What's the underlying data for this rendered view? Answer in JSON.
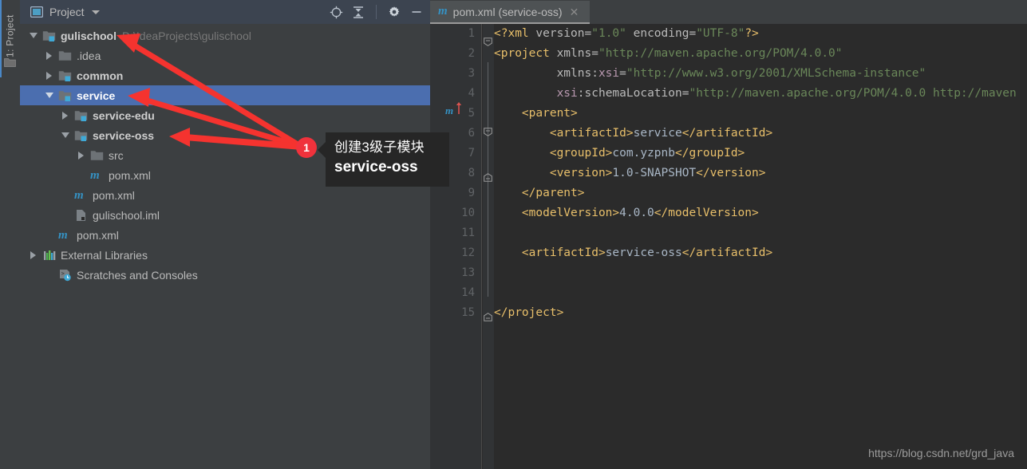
{
  "toolwindow": {
    "vertical_label": "1: Project",
    "folder_icon": "folder-icon"
  },
  "panel": {
    "title": "Project",
    "project_icon": "project-window-icon",
    "dropdown_icon": "chevron-down-icon",
    "tools": [
      {
        "name": "locate-in-tree-icon",
        "label": "Select Opened File"
      },
      {
        "name": "collapse-all-icon",
        "label": "Collapse All"
      },
      {
        "name": "settings-gear-icon",
        "label": "Settings"
      },
      {
        "name": "hide-icon",
        "label": "Hide"
      }
    ]
  },
  "tree": [
    {
      "label": "gulischool",
      "path": "D:\\IdeaProjects\\gulischool",
      "icon": "module-folder-icon",
      "arrow": "down",
      "indent": 0,
      "bold": true,
      "selected": false
    },
    {
      "label": ".idea",
      "path": "",
      "icon": "folder-icon",
      "arrow": "right",
      "indent": 1,
      "bold": false,
      "selected": false
    },
    {
      "label": "common",
      "path": "",
      "icon": "module-folder-icon",
      "arrow": "right",
      "indent": 1,
      "bold": true,
      "selected": false
    },
    {
      "label": "service",
      "path": "",
      "icon": "module-folder-icon",
      "arrow": "down",
      "indent": 1,
      "bold": true,
      "selected": true
    },
    {
      "label": "service-edu",
      "path": "",
      "icon": "module-folder-icon",
      "arrow": "right",
      "indent": 2,
      "bold": true,
      "selected": false
    },
    {
      "label": "service-oss",
      "path": "",
      "icon": "module-folder-icon",
      "arrow": "down",
      "indent": 2,
      "bold": true,
      "selected": false
    },
    {
      "label": "src",
      "path": "",
      "icon": "folder-icon",
      "arrow": "right",
      "indent": 3,
      "bold": false,
      "selected": false
    },
    {
      "label": "pom.xml",
      "path": "",
      "icon": "maven-icon",
      "arrow": "none",
      "indent": 3,
      "bold": false,
      "selected": false
    },
    {
      "label": "pom.xml",
      "path": "",
      "icon": "maven-icon",
      "arrow": "none",
      "indent": 2,
      "bold": false,
      "selected": false
    },
    {
      "label": "gulischool.iml",
      "path": "",
      "icon": "iml-file-icon",
      "arrow": "none",
      "indent": 2,
      "bold": false,
      "selected": false
    },
    {
      "label": "pom.xml",
      "path": "",
      "icon": "maven-icon",
      "arrow": "none",
      "indent": 1,
      "bold": false,
      "selected": false
    },
    {
      "label": "External Libraries",
      "path": "",
      "icon": "libraries-icon",
      "arrow": "right",
      "indent": 0,
      "bold": false,
      "selected": false
    },
    {
      "label": "Scratches and Consoles",
      "path": "",
      "icon": "scratches-icon",
      "arrow": "none",
      "indent": 1,
      "bold": false,
      "selected": false
    }
  ],
  "editor": {
    "tab": {
      "icon": "maven-icon",
      "title": "pom.xml (service-oss)",
      "close_icon": "close-icon"
    },
    "line_numbers": [
      "1",
      "2",
      "3",
      "4",
      "5",
      "6",
      "7",
      "8",
      "9",
      "10",
      "11",
      "12",
      "13",
      "14",
      "15"
    ],
    "gutter_maven_marker": "maven-reimport-icon",
    "lines": [
      {
        "n": "1",
        "indent": 0,
        "tokens": [
          {
            "c": "t-pi",
            "t": "<?xml "
          },
          {
            "c": "t-attr",
            "t": "version="
          },
          {
            "c": "t-str",
            "t": "\"1.0\""
          },
          {
            "c": "t-attr",
            "t": " encoding="
          },
          {
            "c": "t-str",
            "t": "\"UTF-8\""
          },
          {
            "c": "t-pi",
            "t": "?>"
          }
        ]
      },
      {
        "n": "2",
        "indent": 0,
        "tokens": [
          {
            "c": "t-tag",
            "t": "<project "
          },
          {
            "c": "t-attr",
            "t": "xmlns="
          },
          {
            "c": "t-str",
            "t": "\"http://maven.apache.org/POM/4.0.0\""
          }
        ]
      },
      {
        "n": "3",
        "indent": 0,
        "tokens": [
          {
            "c": "t-attr",
            "t": "         xmlns:"
          },
          {
            "c": "t-ns",
            "t": "xsi"
          },
          {
            "c": "t-attr",
            "t": "="
          },
          {
            "c": "t-str",
            "t": "\"http://www.w3.org/2001/XMLSchema-instance\""
          }
        ]
      },
      {
        "n": "4",
        "indent": 0,
        "tokens": [
          {
            "c": "t-attr",
            "t": "         "
          },
          {
            "c": "t-ns",
            "t": "xsi"
          },
          {
            "c": "t-attr",
            "t": ":schemaLocation="
          },
          {
            "c": "t-str",
            "t": "\"http://maven.apache.org/POM/4.0.0 http://maven"
          }
        ]
      },
      {
        "n": "5",
        "indent": 0,
        "tokens": [
          {
            "c": "t-tag",
            "t": "    <parent>"
          }
        ]
      },
      {
        "n": "6",
        "indent": 0,
        "tokens": [
          {
            "c": "t-tag",
            "t": "        <artifactId>"
          },
          {
            "c": "t-text",
            "t": "service"
          },
          {
            "c": "t-tag",
            "t": "</artifactId>"
          }
        ]
      },
      {
        "n": "7",
        "indent": 0,
        "tokens": [
          {
            "c": "t-tag",
            "t": "        <groupId>"
          },
          {
            "c": "t-text",
            "t": "com.yzpnb"
          },
          {
            "c": "t-tag",
            "t": "</groupId>"
          }
        ]
      },
      {
        "n": "8",
        "indent": 0,
        "tokens": [
          {
            "c": "t-tag",
            "t": "        <version>"
          },
          {
            "c": "t-text",
            "t": "1.0-SNAPSHOT"
          },
          {
            "c": "t-tag",
            "t": "</version>"
          }
        ]
      },
      {
        "n": "9",
        "indent": 0,
        "tokens": [
          {
            "c": "t-tag",
            "t": "    </parent>"
          }
        ]
      },
      {
        "n": "10",
        "indent": 0,
        "tokens": [
          {
            "c": "t-tag",
            "t": "    <modelVersion>"
          },
          {
            "c": "t-text",
            "t": "4.0.0"
          },
          {
            "c": "t-tag",
            "t": "</modelVersion>"
          }
        ]
      },
      {
        "n": "11",
        "indent": 0,
        "tokens": []
      },
      {
        "n": "12",
        "indent": 0,
        "tokens": [
          {
            "c": "t-tag",
            "t": "    <artifactId>"
          },
          {
            "c": "t-text",
            "t": "service-oss"
          },
          {
            "c": "t-tag",
            "t": "</artifactId>"
          }
        ]
      },
      {
        "n": "13",
        "indent": 0,
        "tokens": []
      },
      {
        "n": "14",
        "indent": 0,
        "tokens": []
      },
      {
        "n": "15",
        "indent": 0,
        "tokens": [
          {
            "c": "t-tag",
            "t": "</project>"
          }
        ]
      }
    ]
  },
  "annotation": {
    "badge_number": "1",
    "callout_line1": "创建3级子模块",
    "callout_line2": "service-oss",
    "arrow_color": "#f5332f",
    "badge_color": "#f0323c"
  },
  "watermark": "https://blog.csdn.net/grd_java"
}
